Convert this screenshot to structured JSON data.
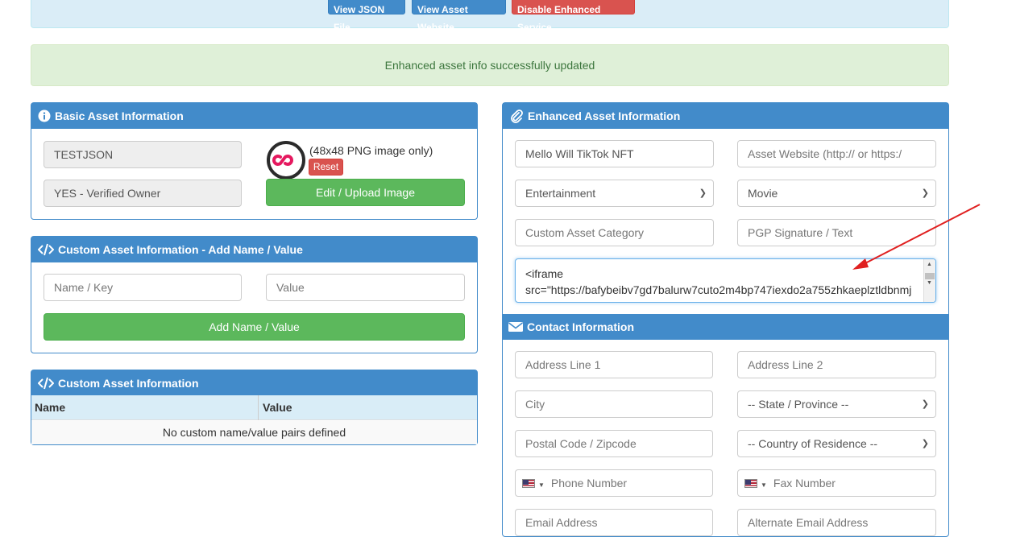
{
  "top_bar": {
    "view_json_label": "View JSON File",
    "view_website_label": "View Asset Website",
    "disable_label": "Disable Enhanced Service"
  },
  "alert": {
    "message": "Enhanced asset info successfully updated"
  },
  "basic": {
    "title": "Basic Asset Information",
    "asset_name": "TESTJSON",
    "owner_status": "YES - Verified Owner",
    "image_note": "(48x48 PNG image only)",
    "reset_label": "Reset",
    "upload_label": "Edit / Upload Image"
  },
  "custom_add": {
    "title": "Custom Asset Information - Add Name / Value",
    "name_placeholder": "Name / Key",
    "value_placeholder": "Value",
    "add_label": "Add Name / Value"
  },
  "custom_list": {
    "title": "Custom Asset Information",
    "columns": [
      "Name",
      "Value"
    ],
    "empty_text": "No custom name/value pairs defined"
  },
  "enhanced": {
    "title": "Enhanced Asset Information",
    "description": "Mello Will TikTok NFT",
    "website_placeholder": "Asset Website (http:// or https:/",
    "category": "Entertainment",
    "subcategory": "Movie",
    "custom_category_placeholder": "Custom Asset Category",
    "pgp_placeholder": "PGP Signature / Text",
    "embed_line1": "<iframe",
    "embed_line2": "src=\"https://bafybeibv7gd7balurw7cuto2m4bp747iexdo2a755zhkaeplztldbnmj"
  },
  "contact": {
    "title": "Contact Information",
    "address1_placeholder": "Address Line 1",
    "address2_placeholder": "Address Line 2",
    "city_placeholder": "City",
    "state_selected": "-- State / Province --",
    "postal_placeholder": "Postal Code / Zipcode",
    "country_selected": "-- Country of Residence --",
    "phone_placeholder": "Phone Number",
    "fax_placeholder": "Fax Number",
    "email_placeholder": "Email Address",
    "alt_email_placeholder": "Alternate Email Address"
  },
  "colors": {
    "primary": "#428bca",
    "success": "#5cb85c",
    "danger": "#d9534f",
    "annotation_arrow": "#e02020"
  }
}
